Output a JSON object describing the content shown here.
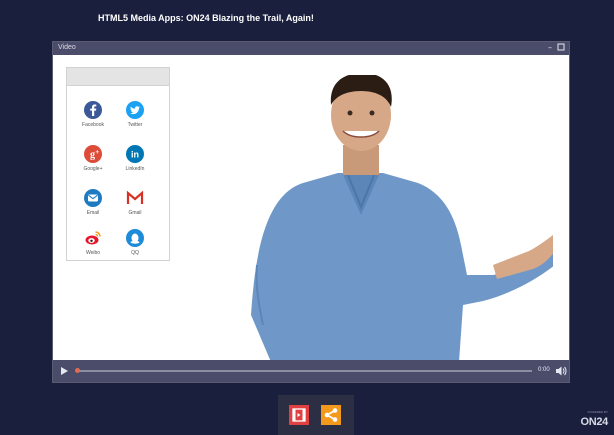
{
  "page": {
    "title": "HTML5 Media Apps: ON24 Blazing the Trail, Again!"
  },
  "video_window": {
    "title": "Video",
    "minimize_icon": "minimize-icon",
    "maximize_icon": "maximize-icon"
  },
  "share_panel": {
    "items": [
      {
        "label": "Facebook",
        "icon": "facebook-icon",
        "color": "#3b5998"
      },
      {
        "label": "Twitter",
        "icon": "twitter-icon",
        "color": "#1da1f2"
      },
      {
        "label": "Google+",
        "icon": "google-plus-icon",
        "color": "#dd4b39"
      },
      {
        "label": "LinkedIn",
        "icon": "linkedin-icon",
        "color": "#0077b5"
      },
      {
        "label": "Email",
        "icon": "email-icon",
        "color": "#1f7bc1"
      },
      {
        "label": "Gmail",
        "icon": "gmail-icon",
        "color": "#d93025"
      },
      {
        "label": "Weibo",
        "icon": "weibo-icon",
        "color": "#e6162d"
      },
      {
        "label": "QQ",
        "icon": "qq-icon",
        "color": "#1e8bd8"
      }
    ]
  },
  "player": {
    "time": "0:00",
    "play_icon": "play-icon",
    "volume_icon": "volume-icon"
  },
  "toolbar": {
    "slides_icon": "slides-icon",
    "share_icon": "share-icon",
    "slides_color": "#e04040",
    "share_color": "#f39a1c"
  },
  "brand": {
    "powered": "POWERED BY",
    "logo": "ON24"
  }
}
